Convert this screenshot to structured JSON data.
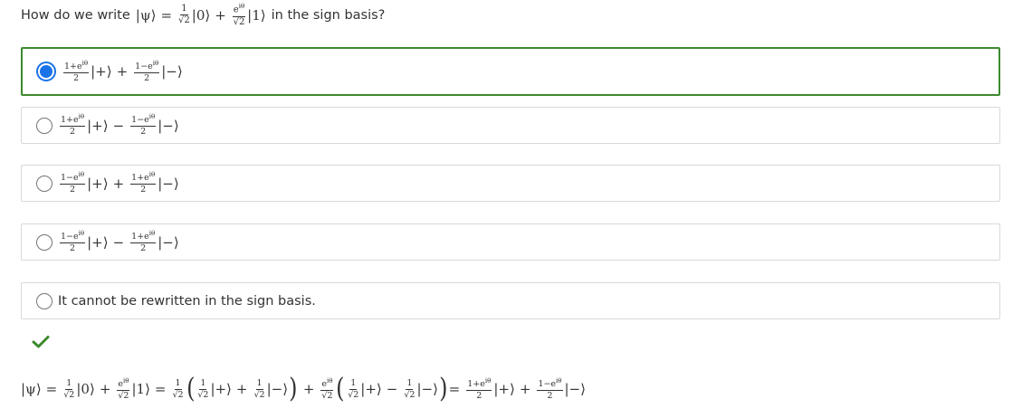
{
  "question": {
    "text_before": "How do we write",
    "ket_psi": "|ψ⟩",
    "equals": "=",
    "frac1_num": "1",
    "frac1_den": "√2",
    "ket0": "|0⟩",
    "plus": "+",
    "frac2_num": "e",
    "frac2_sup": "iθ",
    "frac2_den": "√2",
    "ket1": "|1⟩",
    "text_after": "in the sign basis?"
  },
  "options": [
    {
      "coef1_num": "1+e",
      "coef1_sup": "iθ",
      "coef1_den": "2",
      "ket_plus": "|+⟩",
      "op": "+",
      "coef2_num": "1−e",
      "coef2_sup": "iθ",
      "coef2_den": "2",
      "ket_minus": "|−⟩",
      "selected": true
    },
    {
      "coef1_num": "1+e",
      "coef1_sup": "iθ",
      "coef1_den": "2",
      "ket_plus": "|+⟩",
      "op": "−",
      "coef2_num": "1−e",
      "coef2_sup": "iθ",
      "coef2_den": "2",
      "ket_minus": "|−⟩",
      "selected": false
    },
    {
      "coef1_num": "1−e",
      "coef1_sup": "iθ",
      "coef1_den": "2",
      "ket_plus": "|+⟩",
      "op": "+",
      "coef2_num": "1+e",
      "coef2_sup": "iθ",
      "coef2_den": "2",
      "ket_minus": "|−⟩",
      "selected": false
    },
    {
      "coef1_num": "1−e",
      "coef1_sup": "iθ",
      "coef1_den": "2",
      "ket_plus": "|+⟩",
      "op": "−",
      "coef2_num": "1+e",
      "coef2_sup": "iθ",
      "coef2_den": "2",
      "ket_minus": "|−⟩",
      "selected": false
    }
  ],
  "option5_text": "It cannot be rewritten in the sign basis.",
  "colors": {
    "correct_border": "#3c8a2e",
    "radio_checked": "#1a73e8",
    "check_mark": "#3c8a2e"
  },
  "icons": {
    "check": "check-icon"
  },
  "explanation": {
    "psi": "|ψ⟩",
    "eq": "=",
    "one": "1",
    "sqrt2": "√2",
    "ket0": "|0⟩",
    "plus": "+",
    "e": "e",
    "itheta": "iθ",
    "ket1": "|1⟩",
    "lparen": "(",
    "rparen": ")",
    "ketp": "|+⟩",
    "ketm": "|−⟩",
    "minus": "−",
    "final_num1": "1+e",
    "final_num2": "1−e",
    "two": "2"
  }
}
